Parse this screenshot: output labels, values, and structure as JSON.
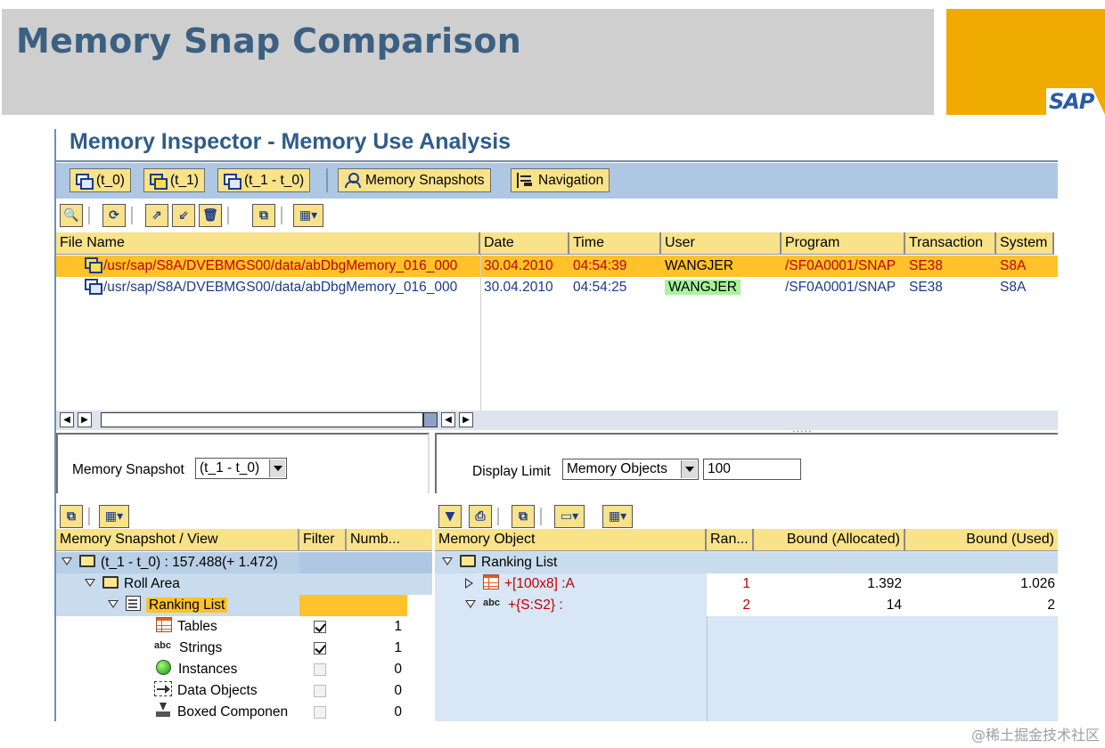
{
  "slide": {
    "title": "Memory Snap Comparison",
    "logo_text": "SAP",
    "watermark": "@稀土掘金技术社区",
    "colors": {
      "title": "#3c6082",
      "brand": "#f0ab00",
      "header_bg": "#cfcfcf"
    }
  },
  "inspector": {
    "title": "Memory Inspector - Memory Use Analysis",
    "toolbar1": {
      "buttons": [
        {
          "label": "(t_0)",
          "icon": "window-icon"
        },
        {
          "label": "(t_1)",
          "icon": "window-yellow-icon"
        },
        {
          "label": "(t_1 - t_0)",
          "icon": "window-icon"
        },
        {
          "label": "Memory Snapshots",
          "icon": "person-icon"
        },
        {
          "label": "Navigation",
          "icon": "tree-icon"
        }
      ]
    },
    "toolbar2": {
      "icons": [
        "details-icon",
        "refresh-icon",
        "export-icon",
        "import-icon",
        "delete-icon",
        "find-icon",
        "layout-icon"
      ]
    },
    "file_table": {
      "columns": [
        "File Name",
        "Date",
        "Time",
        "User",
        "Program",
        "Transaction",
        "System"
      ],
      "rows": [
        {
          "file": "/usr/sap/S8A/DVEBMGS00/data/abDbgMemory_016_000",
          "date": "30.04.2010",
          "time": "04:54:39",
          "user": "WANGJER",
          "program": "/SF0A0001/SNAP",
          "transaction": "SE38",
          "system": "S8A",
          "selected": true
        },
        {
          "file": "/usr/sap/S8A/DVEBMGS00/data/abDbgMemory_016_000",
          "date": "30.04.2010",
          "time": "04:54:25",
          "user": "WANGJER",
          "program": "/SF0A0001/SNAP",
          "transaction": "SE38",
          "system": "S8A",
          "selected": false
        }
      ]
    },
    "scroll_dots": ".....",
    "snapshot_selector": {
      "label": "Memory Snapshot",
      "value": "(t_1 - t_0)"
    },
    "display_limit": {
      "label": "Display Limit",
      "value": "Memory Objects",
      "count": "100"
    },
    "left_tree": {
      "columns": [
        "Memory Snapshot / View",
        "Filter",
        "Numb..."
      ],
      "rows": [
        {
          "label": "(t_1 - t_0) : 157.488(+ 1.472)",
          "icon": "folder-icon"
        },
        {
          "label": "Roll Area",
          "icon": "folder-icon"
        },
        {
          "label": "Ranking List",
          "icon": "list-icon"
        },
        {
          "label": "Tables",
          "icon": "table-icon",
          "filter": true,
          "number": "1"
        },
        {
          "label": "Strings",
          "icon": "strings-icon",
          "filter": true,
          "number": "1"
        },
        {
          "label": "Instances",
          "icon": "instance-icon",
          "filter": false,
          "number": "0"
        },
        {
          "label": "Data Objects",
          "icon": "data-object-icon",
          "filter": false,
          "number": "0"
        },
        {
          "label": "Boxed Componen",
          "icon": "boxed-component-icon",
          "filter": false,
          "number": "0"
        }
      ]
    },
    "right_tree": {
      "columns": [
        "Memory Object",
        "Ran...",
        "Bound (Allocated)",
        "Bound (Used)"
      ],
      "rows": [
        {
          "label": "Ranking List",
          "icon": "folder-icon"
        },
        {
          "label": "+[100x8] :A",
          "icon": "table-icon",
          "rank": "1",
          "allocated": "1.392",
          "used": "1.026"
        },
        {
          "label": "+{S:S2} :",
          "icon": "strings-icon",
          "rank": "2",
          "allocated": "14",
          "used": "2"
        }
      ]
    }
  }
}
